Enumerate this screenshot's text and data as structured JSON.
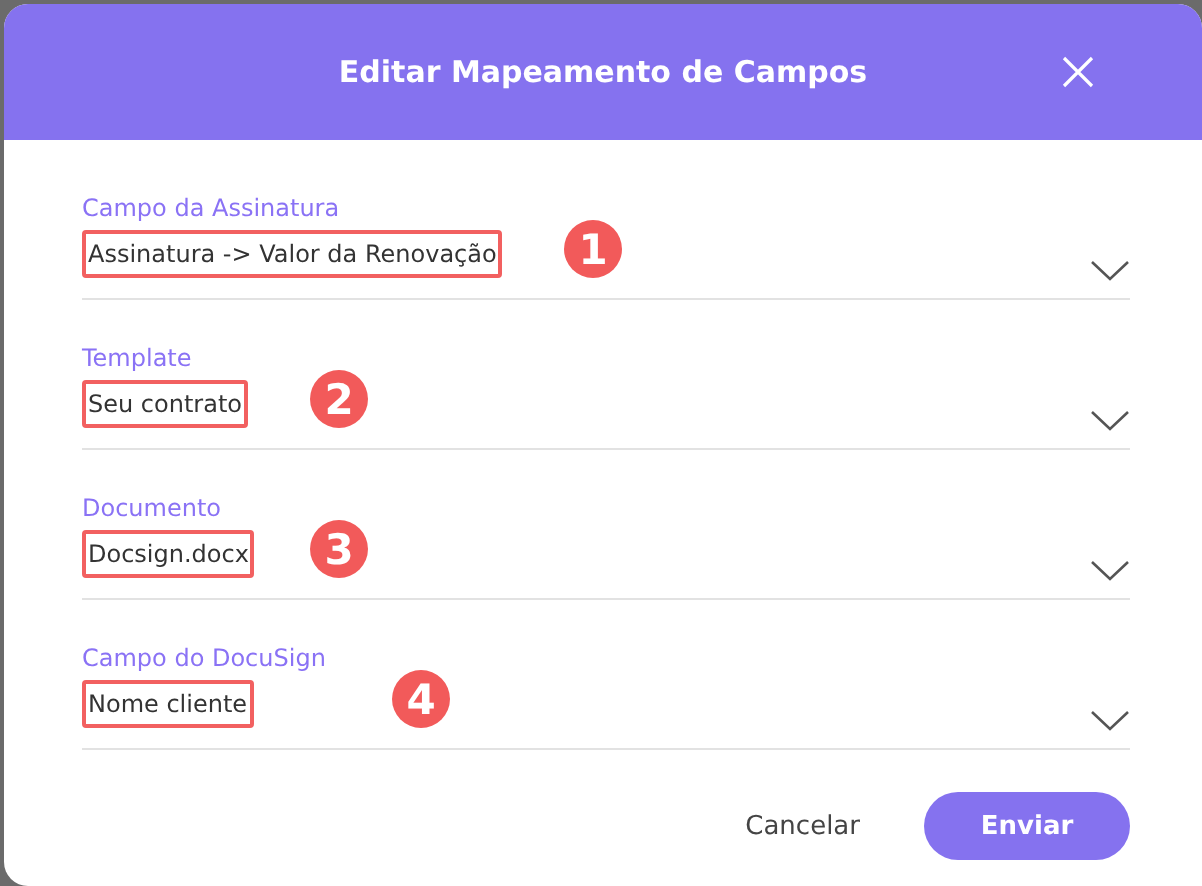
{
  "dialog": {
    "title": "Editar Mapeamento de Campos"
  },
  "fields": [
    {
      "label": "Campo da Assinatura",
      "value": "Assinatura -> Valor da Renovação",
      "marker": "1"
    },
    {
      "label": "Template",
      "value": "Seu contrato",
      "marker": "2"
    },
    {
      "label": "Documento",
      "value": "Docsign.docx",
      "marker": "3"
    },
    {
      "label": "Campo do DocuSign",
      "value": "Nome cliente",
      "marker": "4"
    }
  ],
  "buttons": {
    "cancel": "Cancelar",
    "submit": "Enviar"
  }
}
